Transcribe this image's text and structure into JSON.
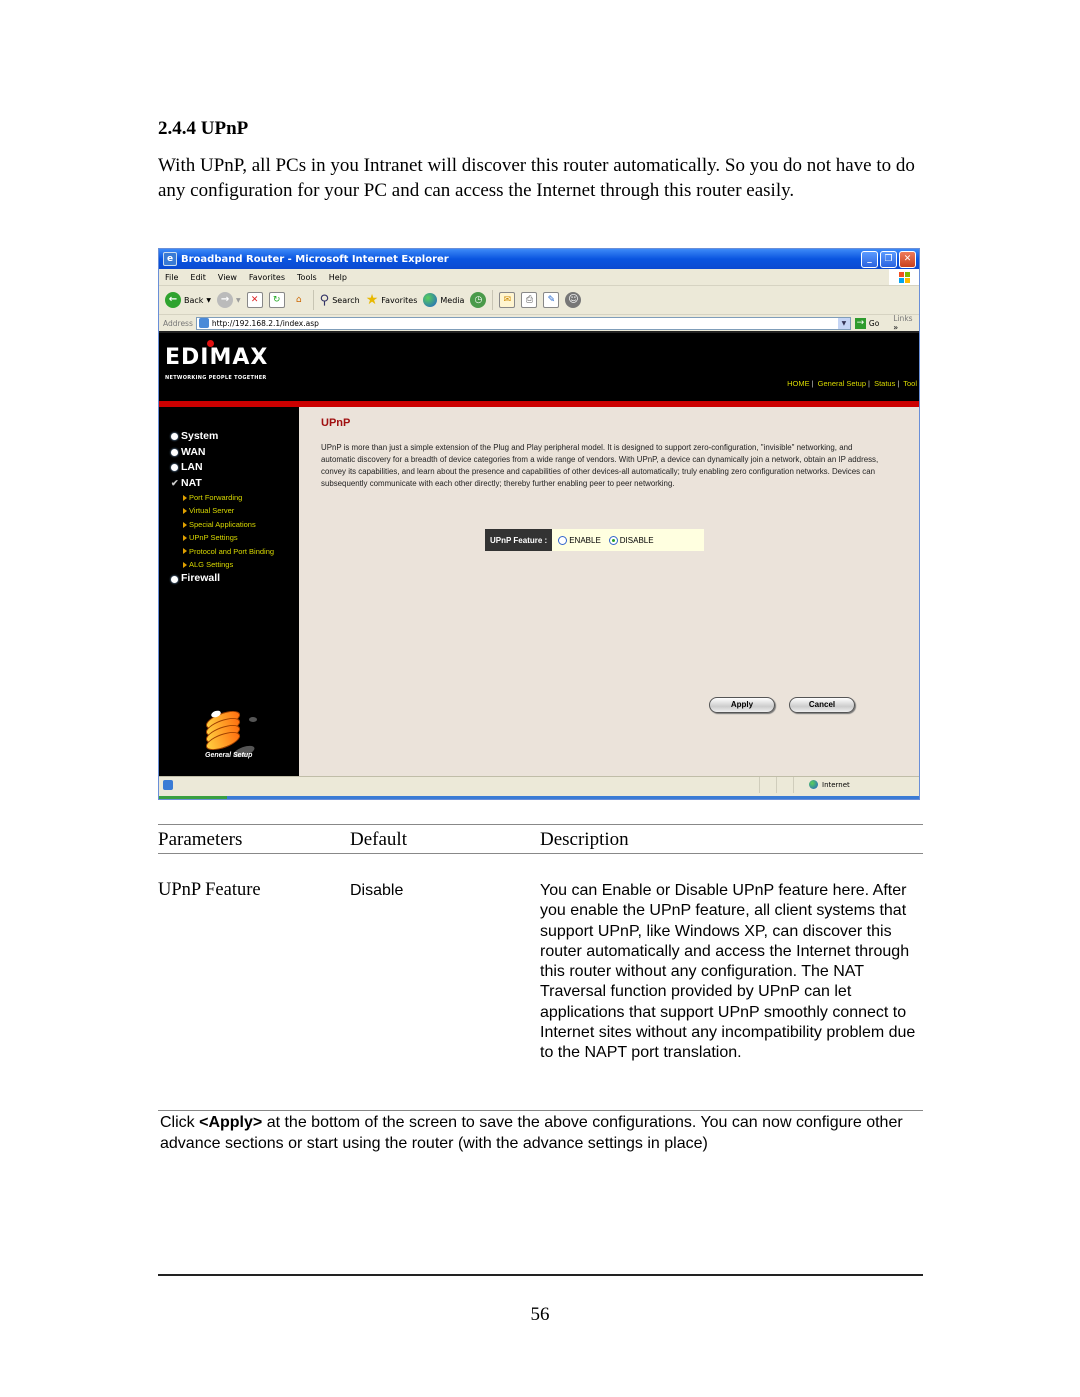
{
  "section": {
    "title": "2.4.4 UPnP",
    "intro": "With UPnP, all PCs in you Intranet will discover this router automatically. So you do not have to do any configuration for your PC and can access the Internet through this router easily."
  },
  "browser": {
    "window_title": "Broadband Router - Microsoft Internet Explorer",
    "window_buttons": {
      "minimize": "_",
      "maximize": "❐",
      "close": "✕"
    },
    "menu": [
      "File",
      "Edit",
      "View",
      "Favorites",
      "Tools",
      "Help"
    ],
    "toolbar": {
      "back": "Back",
      "search": "Search",
      "favorites": "Favorites",
      "media": "Media"
    },
    "address": {
      "label": "Address",
      "url": "http://192.168.2.1/index.asp",
      "go": "Go",
      "links": "Links",
      "links_more": "»"
    },
    "status": {
      "zone": "Internet"
    }
  },
  "router": {
    "brand": "EDIMAX",
    "tagline": "NETWORKING PEOPLE TOGETHER",
    "topnav": [
      "HOME",
      "General Setup",
      "Status",
      "Tool"
    ],
    "menu": [
      {
        "label": "System",
        "icon": "bullet"
      },
      {
        "label": "WAN",
        "icon": "bullet"
      },
      {
        "label": "LAN",
        "icon": "bullet"
      },
      {
        "label": "NAT",
        "icon": "check"
      }
    ],
    "submenu": [
      "Port Forwarding",
      "Virtual Server",
      "Special Applications",
      "UPnP Settings",
      "Protocol and Port Binding",
      "ALG Settings"
    ],
    "menu_after": "Firewall",
    "graphic_label": "General Setup",
    "content": {
      "title": "UPnP",
      "description": "UPnP is more than just a simple extension of the Plug and Play peripheral model. It is designed to support zero-configuration, \"invisible\" networking, and automatic discovery for a breadth of device categories from a wide range of vendors. With UPnP, a device can dynamically join a network, obtain an IP address, convey its capabilities, and learn about the presence and capabilities of other devices-all automatically; truly enabling zero configuration networks. Devices can subsequently communicate with each other directly; thereby further enabling peer to peer networking.",
      "feature_label": "UPnP Feature :",
      "options": [
        "ENABLE",
        "DISABLE"
      ],
      "selected": "DISABLE",
      "apply": "Apply",
      "cancel": "Cancel"
    }
  },
  "table": {
    "headers": [
      "Parameters",
      "Default",
      "Description"
    ],
    "rows": [
      {
        "parameter": "UPnP Feature",
        "default": "Disable",
        "description": "You can Enable or Disable UPnP feature here. After you enable the UPnP feature, all client systems that support UPnP, like Windows XP, can discover this router automatically and access the Internet through this router without any configuration. The NAT Traversal function provided by UPnP can let applications that support UPnP smoothly connect to Internet sites without any incompatibility problem due to the NAPT port translation."
      }
    ]
  },
  "note": {
    "prefix": "Click ",
    "bold": "<Apply>",
    "suffix": " at the bottom of the screen to save the above configurations. You can now configure other advance sections or start using the router (with the advance settings in place)"
  },
  "page_number": "56"
}
